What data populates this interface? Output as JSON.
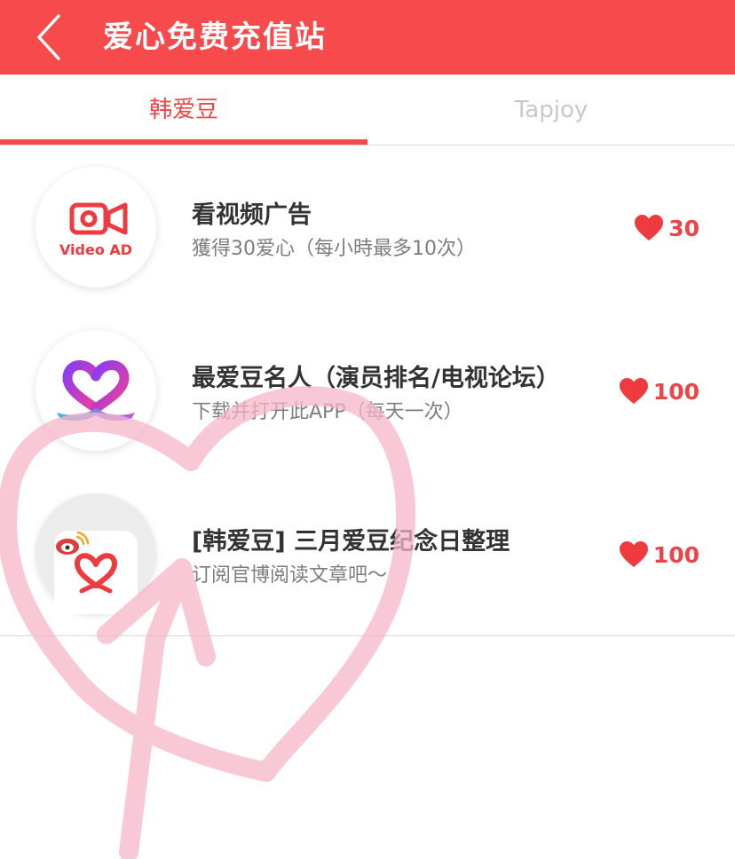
{
  "header": {
    "title": "爱心免费充值站",
    "back_icon": "chevron-left-icon"
  },
  "tabs": [
    {
      "label": "韩爱豆",
      "active": true
    },
    {
      "label": "Tapjoy",
      "active": false
    }
  ],
  "items": [
    {
      "icon": "video-ad-icon",
      "icon_caption": "Video AD",
      "title": "看视频广告",
      "subtitle": "獲得30爱心（每小時最多10次）",
      "reward": "30",
      "reward_icon": "heart-icon"
    },
    {
      "icon": "app-logo-heart-ribbon-icon",
      "title": "最爱豆名人（演员排名/电视论坛）",
      "subtitle": "下载并打开此APP（每天一次）",
      "reward": "100",
      "reward_icon": "heart-icon"
    },
    {
      "icon": "weibo-heart-icon",
      "title": "[韩爱豆] 三月爱豆纪念日整理",
      "subtitle": "订阅官博阅读文章吧～",
      "reward": "100",
      "reward_icon": "heart-icon"
    }
  ],
  "colors": {
    "accent": "#f64a4c",
    "tab_inactive": "#c8c8c8",
    "subtitle": "#7d7d7d",
    "overlay_pink": "#f7b6c8"
  }
}
